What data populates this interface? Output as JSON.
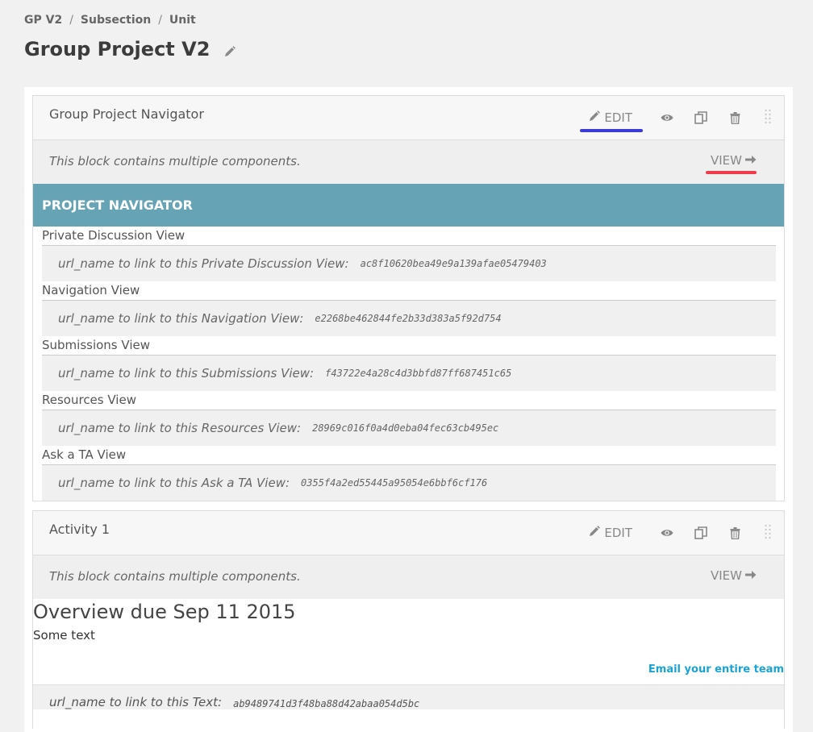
{
  "breadcrumb": [
    "GP V2",
    "Subsection",
    "Unit"
  ],
  "page_title": "Group Project V2",
  "blocks": [
    {
      "title": "Group Project Navigator",
      "edit_label": "EDIT",
      "note": "This block contains multiple components.",
      "view_label": "VIEW",
      "nav_header": "PROJECT NAVIGATOR",
      "items": [
        {
          "label": "Private Discussion View",
          "url_text": "url_name to link to this Private Discussion View:",
          "code": "ac8f10620bea49e9a139afae05479403"
        },
        {
          "label": "Navigation View",
          "url_text": "url_name to link to this Navigation View:",
          "code": "e2268be462844fe2b33d383a5f92d754"
        },
        {
          "label": "Submissions View",
          "url_text": "url_name to link to this Submissions View:",
          "code": "f43722e4a28c4d3bbfd87ff687451c65"
        },
        {
          "label": "Resources View",
          "url_text": "url_name to link to this Resources View:",
          "code": "28969c016f0a4d0eba04fec63cb495ec"
        },
        {
          "label": "Ask a TA View",
          "url_text": "url_name to link to this Ask a TA View:",
          "code": "0355f4a2ed55445a95054e6bbf6cf176"
        }
      ]
    },
    {
      "title": "Activity 1",
      "edit_label": "EDIT",
      "note": "This block contains multiple components.",
      "view_label": "VIEW",
      "overview_title": "Overview due Sep 11 2015",
      "overview_text": "Some text",
      "email_link": "Email your entire team",
      "text_url": "url_name to link to this Text:",
      "text_code": "ab9489741d3f48ba88d42abaa054d5bc"
    }
  ],
  "colors": {
    "nav_header_bg": "#65a3b5",
    "highlight_blue": "#3b3bd8",
    "highlight_red": "#ef3b4a",
    "link": "#1aa3d4"
  },
  "icons": [
    "pencil-icon",
    "eye-icon",
    "duplicate-icon",
    "trash-icon",
    "drag-handle-icon",
    "arrow-right-icon"
  ]
}
